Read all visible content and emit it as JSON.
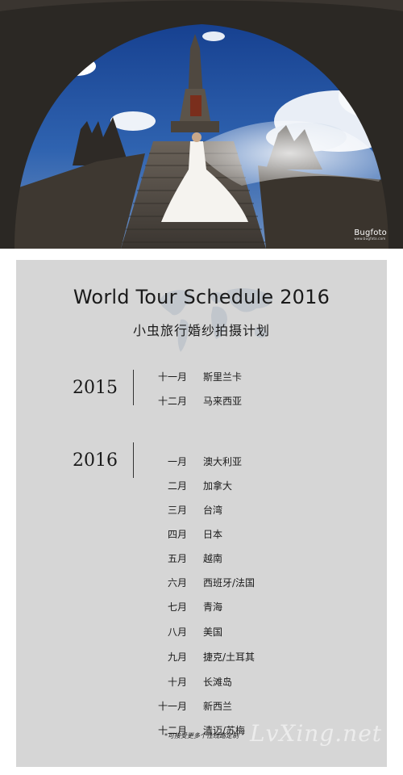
{
  "photo": {
    "brand": "Bugfoto",
    "brand_url": "www.bugfoto.com"
  },
  "schedule": {
    "title": "World Tour Schedule 2016",
    "subtitle": "小虫旅行婚纱拍摄计划",
    "years": [
      {
        "year": "2015",
        "entries": [
          {
            "month": "十一月",
            "place": "斯里兰卡"
          },
          {
            "month": "十二月",
            "place": "马来西亚"
          }
        ]
      },
      {
        "year": "2016",
        "entries": [
          {
            "month": "一月",
            "place": "澳大利亚"
          },
          {
            "month": "二月",
            "place": "加拿大"
          },
          {
            "month": "三月",
            "place": "台湾"
          },
          {
            "month": "四月",
            "place": "日本"
          },
          {
            "month": "五月",
            "place": "越南"
          },
          {
            "month": "六月",
            "place": "西班牙/法国"
          },
          {
            "month": "七月",
            "place": "青海"
          },
          {
            "month": "八月",
            "place": "美国"
          },
          {
            "month": "九月",
            "place": "捷克/土耳其"
          },
          {
            "month": "十月",
            "place": "长滩岛"
          },
          {
            "month": "十一月",
            "place": "新西兰"
          },
          {
            "month": "十二月",
            "place": "清迈/苏梅"
          }
        ]
      }
    ],
    "footnote": "*可接受更多个性线路定制",
    "site_watermark": "LvXing.net"
  }
}
